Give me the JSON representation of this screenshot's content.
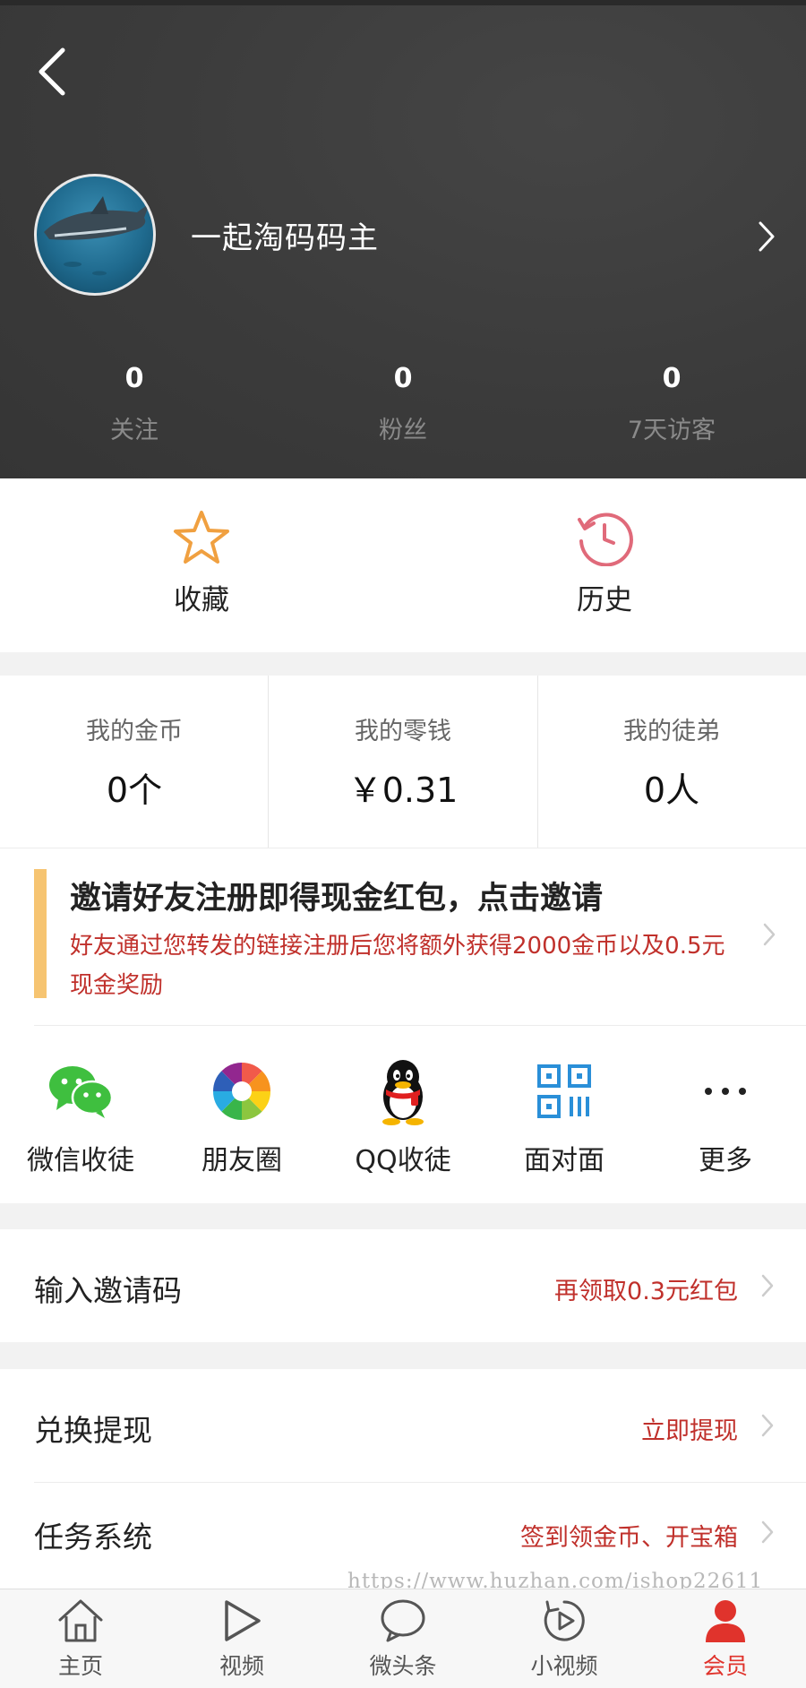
{
  "header": {
    "username": "一起淘码码主",
    "stats": [
      {
        "value": "0",
        "label": "关注"
      },
      {
        "value": "0",
        "label": "粉丝"
      },
      {
        "value": "0",
        "label": "7天访客"
      }
    ]
  },
  "quick": {
    "favorites_label": "收藏",
    "history_label": "历史"
  },
  "wallet": [
    {
      "title": "我的金币",
      "value": "0个"
    },
    {
      "title": "我的零钱",
      "value": "￥0.31"
    },
    {
      "title": "我的徒弟",
      "value": "0人"
    }
  ],
  "invite": {
    "title": "邀请好友注册即得现金红包，点击邀请",
    "description": "好友通过您转发的链接注册后您将额外获得2000金币以及0.5元现金奖励",
    "share": [
      {
        "label": "微信收徒",
        "icon": "wechat-icon"
      },
      {
        "label": "朋友圈",
        "icon": "moments-icon"
      },
      {
        "label": "QQ收徒",
        "icon": "qq-icon"
      },
      {
        "label": "面对面",
        "icon": "qrcode-icon"
      },
      {
        "label": "更多",
        "icon": "more-icon"
      }
    ]
  },
  "rows": {
    "invite_code": {
      "label": "输入邀请码",
      "hint": "再领取0.3元红包"
    },
    "withdraw": {
      "label": "兑换提现",
      "hint": "立即提现"
    },
    "tasks": {
      "label": "任务系统",
      "hint": "签到领金币、开宝箱"
    }
  },
  "watermark": "https://www.huzhan.com/ishop22611",
  "tabbar": [
    {
      "label": "主页",
      "icon": "home-icon"
    },
    {
      "label": "视频",
      "icon": "video-icon"
    },
    {
      "label": "微头条",
      "icon": "chat-bubble-icon"
    },
    {
      "label": "小视频",
      "icon": "short-video-icon"
    },
    {
      "label": "会员",
      "icon": "member-icon",
      "active": true
    }
  ],
  "colors": {
    "accent_red": "#c0302b",
    "active_tab": "#e0332c",
    "header_bg": "#3b3b3b",
    "invite_bar": "#f6c471",
    "star": "#f0a040",
    "history": "#e06a7a",
    "wechat": "#3fbf3f",
    "qrcode": "#2a8fd8"
  }
}
